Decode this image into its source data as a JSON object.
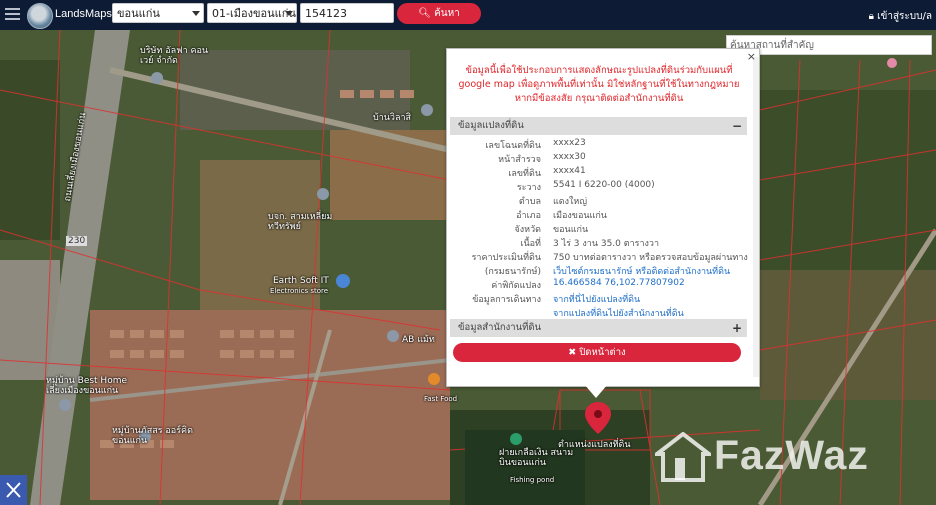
{
  "topbar": {
    "brand": "LandsMaps",
    "province": "ขอนแก่น",
    "district": "01-เมืองขอนแก่น",
    "search_value": "154123",
    "search_button": "ค้นหา",
    "login": "เข้าสู่ระบบ/ล"
  },
  "map": {
    "place_search_placeholder": "ค้นหาสถานที่สำคัญ",
    "labels": [
      "บริษัท อัลฟา คอนเวย์ จำกัด",
      "บ้านวิลาสิ",
      "บจก. สามเหลี่ยม ทวีทรัพย์",
      "Earth Soft IT",
      "Electronics store",
      "AB แม้ท",
      "Fast Food",
      "หมู่บ้าน Best Home เลี่ยงเมืองขอนแก่น",
      "หมู่บ้านภัสสร ออร์คิดขอนแก่น",
      "ตำแหน่งแปลงที่ดิน",
      "ฝายเกลือเงิน สนามบินขอนแก่น",
      "Fishing pond",
      "ถนนเลี่ยงเมืองขอนแก่น",
      "230"
    ]
  },
  "panel": {
    "notice": "ข้อมูลนี้เพื่อใช้ประกอบการแสดงลักษณะรูปแปลงที่ดินร่วมกับแผนที่ google map เพื่อดูภาพพื้นที่เท่านั้น มิใช่หลักฐานที่ใช้ในทางกฎหมาย หากมีข้อสงสัย กรุณาติดต่อสำนักงานที่ดิน",
    "section1_title": "ข้อมูลแปลงที่ดิน",
    "section1_toggle": "−",
    "section2_title": "ข้อมูลสำนักงานที่ดิน",
    "section2_toggle": "+",
    "rows": [
      {
        "label": "เลขโฉนดที่ดิน",
        "value": "xxxx23"
      },
      {
        "label": "หน้าสำรวจ",
        "value": "xxxx30"
      },
      {
        "label": "เลขที่ดิน",
        "value": "xxxx41"
      },
      {
        "label": "ระวาง",
        "value": "5541 I 6220-00 (4000)"
      },
      {
        "label": "ตำบล",
        "value": "แดงใหญ่"
      },
      {
        "label": "อำเภอ",
        "value": "เมืองขอนแก่น"
      },
      {
        "label": "จังหวัด",
        "value": "ขอนแก่น"
      },
      {
        "label": "เนื้อที่",
        "value": "3 ไร่ 3 งาน 35.0 ตารางวา"
      },
      {
        "label": "ราคาประเมินที่ดิน",
        "value": "750 บาทต่อตารางวา หรือตรวจสอบข้อมูลผ่านทาง"
      },
      {
        "label": "(กรมธนารักษ์)",
        "value": "เว็บไซต์กรมธนารักษ์ หรือติดต่อสำนักงานที่ดิน"
      },
      {
        "label": "ค่าพิกัดแปลง",
        "value": "16.466584 76,102.77807902"
      },
      {
        "label": "ข้อมูลการเดินทาง",
        "value": "จากที่นี่ไปยังแปลงที่ดิน"
      },
      {
        "label": "",
        "value": "จากแปลงที่ดินไปยังสำนักงานที่ดิน"
      }
    ],
    "close_button": "ปิดหน้าต่าง"
  },
  "watermark": "FazWaz",
  "colors": {
    "topbar": "#0d1b34",
    "accent_red": "#d9263d",
    "link_blue": "#1e6ec8",
    "parcel_line": "#e03030"
  }
}
